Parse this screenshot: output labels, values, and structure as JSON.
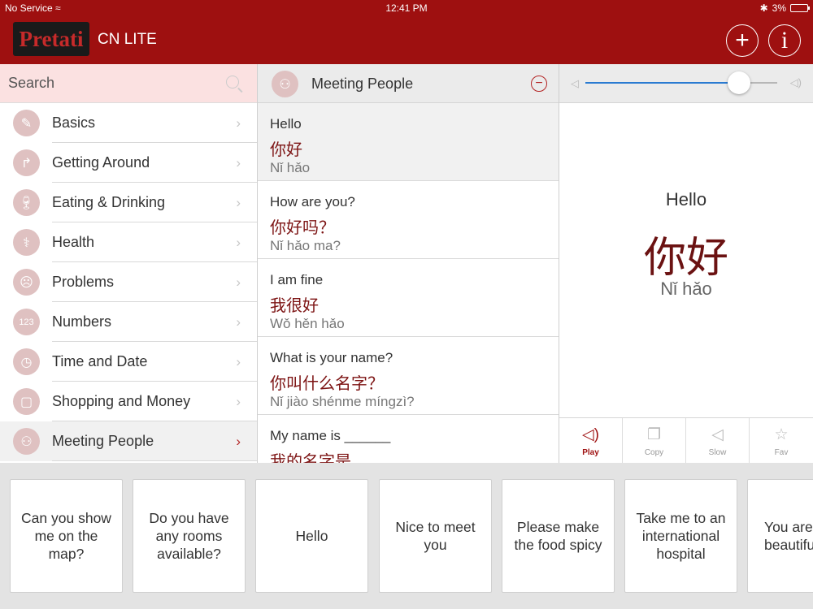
{
  "status_bar": {
    "carrier": "No Service",
    "time": "12:41 PM",
    "battery": "3%"
  },
  "header": {
    "logo_text": "Pretati",
    "subtitle": "CN LITE",
    "add_label": "+",
    "info_label": "i",
    "brand_color": "#9e1010"
  },
  "search": {
    "placeholder": "Search"
  },
  "categories": [
    {
      "label": "Basics",
      "icon": "pencil-icon"
    },
    {
      "label": "Getting Around",
      "icon": "turn-arrow-icon"
    },
    {
      "label": "Eating & Drinking",
      "icon": "wine-icon"
    },
    {
      "label": "Health",
      "icon": "stethoscope-icon"
    },
    {
      "label": "Problems",
      "icon": "sad-face-icon"
    },
    {
      "label": "Numbers",
      "icon": "numbers-icon"
    },
    {
      "label": "Time and Date",
      "icon": "clock-icon"
    },
    {
      "label": "Shopping and Money",
      "icon": "shopping-bag-icon"
    },
    {
      "label": "Meeting People",
      "icon": "people-icon"
    }
  ],
  "middle": {
    "title": "Meeting People",
    "phrases": [
      {
        "en": "Hello",
        "zh": "你好",
        "py": "Nǐ hǎo"
      },
      {
        "en": "How are you?",
        "zh": "你好吗？",
        "py": "Nǐ hǎo ma?"
      },
      {
        "en": "I am fine",
        "zh": "我很好",
        "py": "Wǒ hěn hǎo"
      },
      {
        "en": "What is your name?",
        "zh": "你叫什么名字？",
        "py": "Nǐ jiào shénme míngzì?"
      },
      {
        "en": "My name is ______",
        "zh": "我的名字是",
        "py": ""
      }
    ]
  },
  "detail": {
    "volume": 0.8,
    "en": "Hello",
    "zh": "你好",
    "py": "Nǐ hǎo",
    "actions": [
      {
        "label": "Play",
        "icon": "speaker-icon"
      },
      {
        "label": "Copy",
        "icon": "copy-icon"
      },
      {
        "label": "Slow",
        "icon": "slow-speaker-icon"
      },
      {
        "label": "Fav",
        "icon": "star-icon"
      }
    ]
  },
  "quick_phrases": [
    "Can you show me on the map?",
    "Do you have any rooms available?",
    "Hello",
    "Nice to meet you",
    "Please make the food spicy",
    "Take me to an international hospital",
    "You are beautiful"
  ]
}
